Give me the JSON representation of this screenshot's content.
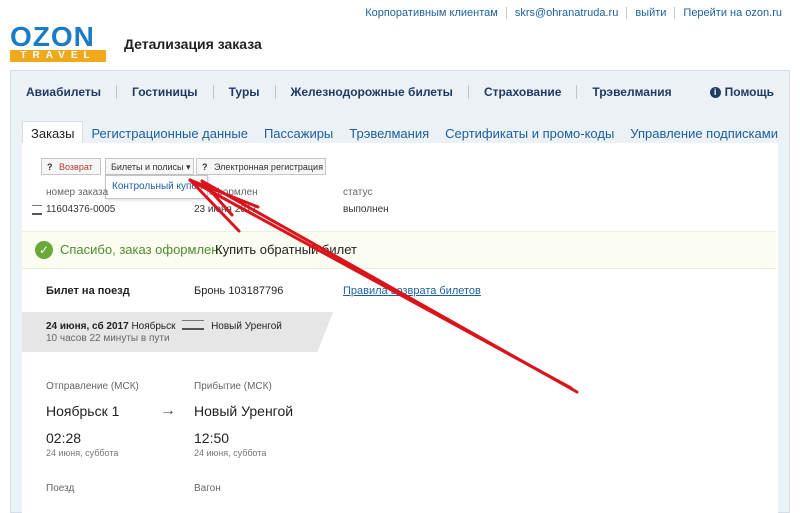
{
  "header": {
    "logo_main": "OZON",
    "logo_sub": "TRAVEL",
    "page_title": "Детализация заказа",
    "links": [
      "Корпоративным клиентам",
      "skrs@ohranatruda.ru",
      "выйти",
      "Перейти на ozon.ru"
    ]
  },
  "nav": {
    "items": [
      "Авиабилеты",
      "Гостиницы",
      "Туры",
      "Железнодорожные билеты",
      "Страхование",
      "Трэвелмания"
    ],
    "help": "Помощь"
  },
  "subtabs": [
    "Заказы",
    "Регистрационные данные",
    "Пассажиры",
    "Трэвелмания",
    "Сертификаты и промо-коды",
    "Управление подписками"
  ],
  "actions": {
    "refund": "Возврат",
    "tickets": "Билеты и полисы ▾",
    "eregistration": "Электронная регистрация",
    "dropdown_item": "Контрольный купон"
  },
  "order": {
    "number_label": "номер заказа",
    "number_value": "11604376-0005",
    "date_label": "оформлен",
    "date_value": "23 июня 2017",
    "status_label": "статус",
    "status_value": "выполнен"
  },
  "banner": {
    "text": "Спасибо, заказ оформлен.",
    "link": "Купить обратный билет"
  },
  "ticket": {
    "label": "Билет на поезд",
    "booking": "Бронь 103187796",
    "rules_link": "Правила возврата билетов"
  },
  "trip": {
    "date": "24 июня, сб 2017",
    "from": "Ноябрьск",
    "to": "Новый Уренгой",
    "duration": "10 часов 22 минуты в пути"
  },
  "departure": {
    "label": "Отправление (МСК)",
    "city": "Ноябрьск 1",
    "time": "02:28",
    "date": "24 июня, суббота"
  },
  "arrival": {
    "label": "Прибытие (МСК)",
    "city": "Новый Уренгой",
    "time": "12:50",
    "date": "24 июня, суббота"
  },
  "train": {
    "train_label": "Поезд",
    "car_label": "Вагон"
  },
  "colors": {
    "brand_blue": "#1a7bc7",
    "brand_orange": "#f0a81c",
    "nav_text": "#1f3b63",
    "success": "#4f8a2f",
    "annotation_red": "#d9141c"
  }
}
